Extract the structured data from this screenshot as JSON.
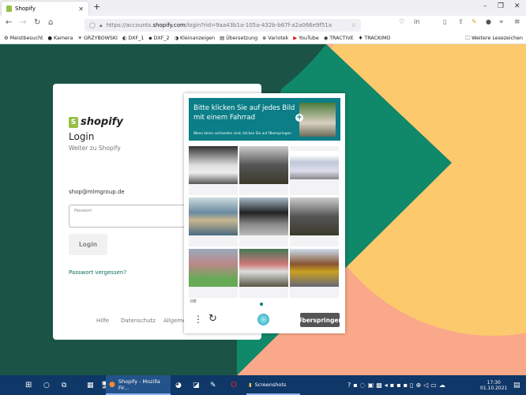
{
  "browser": {
    "tab_title": "Shopify",
    "new_tab": "+",
    "url_prefix": "https://accounts.",
    "url_domain": "shopify.com",
    "url_rest": "/login?rid=9aa43b1a-105a-432b-b67f-a2a066e9f51a",
    "bookmarks": [
      "Meistbesucht",
      "Kamera",
      "GRZYBOWSKI",
      "DXF_1",
      "DXF_2",
      "Kleinanzeigen",
      "Übersetzung",
      "Variotek",
      "YouTube",
      "TRACTIVE",
      "TRACKIMO"
    ],
    "other_bookmarks": "Weitere Lesezeichen"
  },
  "login": {
    "logo_text": "shopify",
    "title": "Login",
    "subtitle": "Weiter zu Shopify",
    "email": "shop@mlmgroup.de",
    "password_label": "Passwort",
    "password_value": "",
    "login_button": "Login",
    "forgot_link": "Passwort vergessen?",
    "footer_links": [
      "Hilfe",
      "Datenschutz",
      "Allgemei"
    ]
  },
  "captcha": {
    "prompt": "Bitte klicken Sie auf jedes Bild mit einem Fahrrad",
    "hint": "Wenn keine vorhanden sind, klicken Sie auf Überspringen",
    "language": "DE",
    "skip_button": "Überspringen",
    "images": [
      "car",
      "cyclists",
      "airplane",
      "kayak",
      "bicycle",
      "cyclists",
      "house",
      "cyclist",
      "man-bus"
    ]
  },
  "colors": {
    "brand_green": "#95bf47",
    "captcha_teal": "#0b7e87",
    "link": "#0b6e5f",
    "bg_dark": "#1b5446",
    "bg_green": "#10886a",
    "bg_yellow": "#fdc96d",
    "bg_salmon": "#f9a989"
  },
  "taskbar": {
    "firefox": "Shopify - Mozilla Fir...",
    "screenshots": "Screenshots",
    "time": "17:30",
    "date": "01.10.2021"
  }
}
